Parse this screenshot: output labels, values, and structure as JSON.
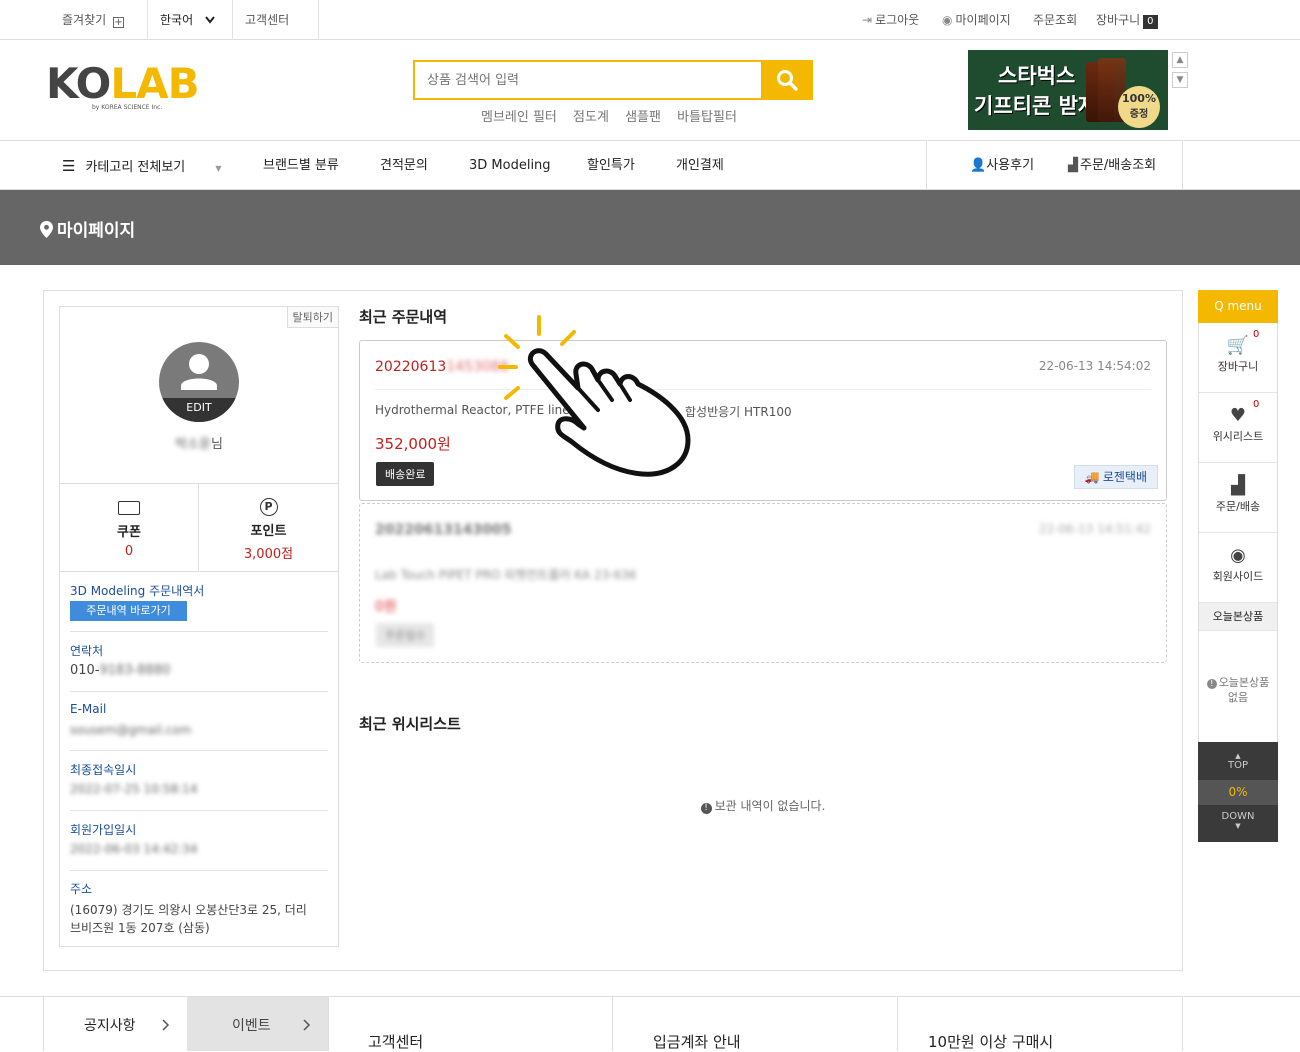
{
  "topbar": {
    "favorites": "즐겨찾기",
    "language": "한국어",
    "support": "고객센터",
    "logout": "로그아웃",
    "mypage": "마이페이지",
    "order_lookup": "주문조회",
    "cart": "장바구니",
    "cart_count": "0"
  },
  "header": {
    "logo_text": "KOLAB",
    "logo_sub": "by KOREA SCIENCE Inc.",
    "search_placeholder": "상품 검색어 입력",
    "keywords": [
      "멤브레인 필터",
      "점도계",
      "샘플팬",
      "바틀탑필터"
    ],
    "banner_line1": "스타벅스",
    "banner_line2": "기프티콘 받자",
    "banner_badge_line1": "100%",
    "banner_badge_line2": "증정"
  },
  "nav": {
    "category_all": "카테고리 전체보기",
    "items": [
      "브랜드별 분류",
      "견적문의",
      "3D Modeling",
      "할인특가",
      "개인결제"
    ],
    "review": "사용후기",
    "order_delivery": "주문/배송조회"
  },
  "page": {
    "title": "마이페이지"
  },
  "profile": {
    "withdraw": "탈퇴하기",
    "avatar_edit": "EDIT",
    "name_blurred": "박소윤",
    "name_suffix": "님",
    "coupon_label": "쿠폰",
    "coupon_value": "0",
    "point_label": "포인트",
    "point_value": "3,000점",
    "modeling_label": "3D Modeling 주문내역서",
    "modeling_button": "주문내역 바로가기",
    "contact_label": "연락처",
    "contact_prefix": "010-",
    "contact_blurred": "9183-8880",
    "email_label": "E-Mail",
    "email_blurred": "sousem@gmail.com",
    "last_login_label": "최종접속일시",
    "last_login_blurred": "2022-07-25 10:58:14",
    "join_label": "회원가입일시",
    "join_blurred": "2022-06-03 14:42:34",
    "address_label": "주소",
    "address_line1": "(16079) 경기도 의왕시 오봉산단3로 25, 더리",
    "address_line2": "브비즈원 1동 207호 (삼동)"
  },
  "orders": {
    "section_title": "최근 주문내역",
    "list": [
      {
        "number_prefix": "20220613",
        "number_blurred": "1453088",
        "date": "22-06-13 14:54:02",
        "product": "Hydrothermal Reactor, PTFE liner",
        "product_tail": "합성반응기 HTR100",
        "price": "352,000원",
        "status": "배송완료",
        "courier": "로젠택배"
      },
      {
        "number_blurred": "20220613143005",
        "date_blurred": "22-06-13 14:51:42",
        "product_blurred": "Lab Touch PIPET PRO 피펫컨트롤러 KA 23-636",
        "price_blurred": "0원",
        "status_blurred": "주문접수"
      }
    ]
  },
  "wishlist": {
    "section_title": "최근 위시리스트",
    "empty_text": "보관 내역이 없습니다."
  },
  "quick_menu": {
    "title": "Q menu",
    "cart_label": "장바구니",
    "cart_count": "0",
    "wish_label": "위시리스트",
    "wish_count": "0",
    "order_label": "주문/배송",
    "member_label": "회원사이드",
    "recent_label": "오늘본상품",
    "recent_empty_line1": "오늘본상품",
    "recent_empty_line2": "없음",
    "top": "TOP",
    "scroll_percent": "0%",
    "down": "DOWN"
  },
  "footer": {
    "notice": "공지사항",
    "event": "이벤트",
    "support": "고객센터",
    "bank": "입금계좌 안내",
    "over100k": "10만원 이상 구매시"
  },
  "colors": {
    "accent": "#f5b800",
    "price_red": "#c0201c",
    "link_blue": "#1a4e9b",
    "title_band": "#666666"
  }
}
